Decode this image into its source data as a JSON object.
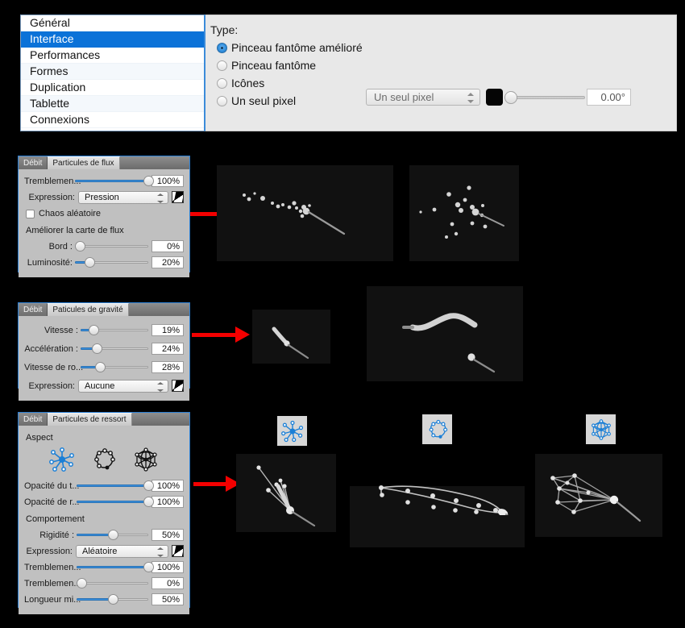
{
  "prefs": {
    "sidebar_items": [
      {
        "label": "Général",
        "selected": false
      },
      {
        "label": "Interface",
        "selected": true
      },
      {
        "label": "Performances",
        "selected": false
      },
      {
        "label": "Formes",
        "selected": false
      },
      {
        "label": "Duplication",
        "selected": false
      },
      {
        "label": "Tablette",
        "selected": false
      },
      {
        "label": "Connexions",
        "selected": false
      }
    ],
    "type_label": "Type:",
    "radios": [
      {
        "label": "Pinceau fantôme amélioré",
        "selected": true
      },
      {
        "label": "Pinceau fantôme",
        "selected": false
      },
      {
        "label": "Icônes",
        "selected": false
      },
      {
        "label": "Un seul pixel",
        "selected": false
      }
    ],
    "icon_combo_value": "Un seul pixel",
    "color_swatch": "#050505",
    "angle_value": "0.00°",
    "angle_percent": 0
  },
  "panels": [
    {
      "tabs": [
        "Débit",
        "Particules de flux"
      ],
      "active_tab_index": 1,
      "controls": [
        {
          "kind": "slider",
          "label": "Tremblemen...",
          "value": "100%",
          "percent": 100
        },
        {
          "kind": "combo",
          "label": "Expression:",
          "value": "Pression"
        },
        {
          "kind": "checkbox",
          "label": "Chaos aléatoire",
          "checked": false
        },
        {
          "kind": "section",
          "label": "Améliorer la carte de flux"
        },
        {
          "kind": "slider",
          "label": "Bord :",
          "value": "0%",
          "percent": 0
        },
        {
          "kind": "slider",
          "label": "Luminosité:",
          "value": "20%",
          "percent": 20
        }
      ]
    },
    {
      "tabs": [
        "Débit",
        "Paticules de gravité"
      ],
      "active_tab_index": 1,
      "controls": [
        {
          "kind": "slider",
          "label": "Vitesse :",
          "value": "19%",
          "percent": 19
        },
        {
          "kind": "slider",
          "label": "Accélération :",
          "value": "24%",
          "percent": 24
        },
        {
          "kind": "slider",
          "label": "Vitesse de ro...",
          "value": "28%",
          "percent": 28
        },
        {
          "kind": "combo",
          "label": "Expression:",
          "value": "Aucune"
        }
      ]
    },
    {
      "tabs": [
        "Débit",
        "Particules de ressort"
      ],
      "active_tab_index": 1,
      "controls": [
        {
          "kind": "section",
          "label": "Aspect"
        },
        {
          "kind": "aspect-icons",
          "icons": [
            "star-spring-icon",
            "loop-spring-icon",
            "mesh-spring-icon"
          ],
          "selected_index": 0
        },
        {
          "kind": "slider",
          "label": "Opacité du t...",
          "value": "100%",
          "percent": 100
        },
        {
          "kind": "slider",
          "label": "Opacité de r...",
          "value": "100%",
          "percent": 100
        },
        {
          "kind": "section",
          "label": "Comportement"
        },
        {
          "kind": "slider",
          "label": "Rigidité :",
          "value": "50%",
          "percent": 50
        },
        {
          "kind": "combo",
          "label": "Expression:",
          "value": "Aléatoire"
        },
        {
          "kind": "slider",
          "label": "Tremblemen...",
          "value": "100%",
          "percent": 100
        },
        {
          "kind": "slider",
          "label": "Tremblemen...",
          "value": "0%",
          "percent": 0
        },
        {
          "kind": "slider",
          "label": "Longueur mi...",
          "value": "50%",
          "percent": 50
        }
      ]
    }
  ],
  "previews": {
    "row1": [
      "flow-particles-preview-a",
      "flow-particles-preview-b"
    ],
    "row2": [
      "gravity-particles-preview-a",
      "gravity-particles-preview-b"
    ],
    "row3": [
      "spring-star-preview",
      "spring-loop-preview",
      "spring-mesh-preview"
    ]
  },
  "accent_color": "#0b72d8",
  "slider_fill_color": "#3c90dd",
  "arrow_color": "#f40000"
}
